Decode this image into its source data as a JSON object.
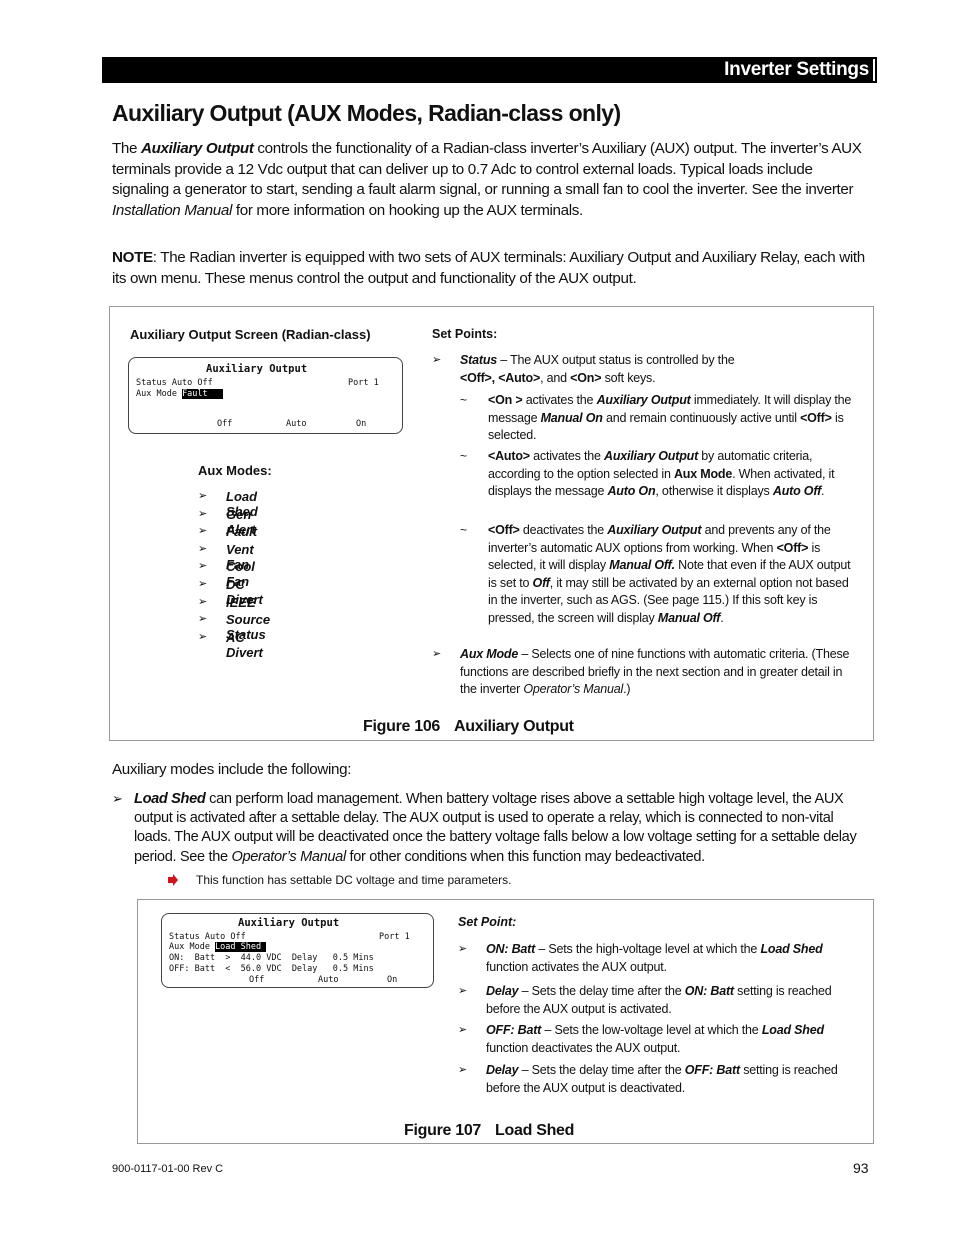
{
  "header": {
    "section_title": "Inverter Settings"
  },
  "page_title": "Auxiliary Output (AUX Modes, Radian-class only)",
  "intro": {
    "p1_a": "The ",
    "p1_em": "Auxiliary Output",
    "p1_b": " controls the functionality of a Radian-class inverter’s Auxiliary (AUX) output.  The inverter’s AUX terminals provide a 12 Vdc output that can deliver up to 0.7 Adc to control external loads.  Typical loads include signaling a generator to start, sending a fault alarm signal, or running a small fan to cool the inverter.  See the inverter ",
    "p1_i": "Installation Manual",
    "p1_c": " for more information on hooking up the AUX terminals.",
    "note_label": "NOTE",
    "note_text": ":  The Radian inverter is equipped with two sets of AUX terminals: Auxiliary Output and Auxiliary Relay, each with its own menu.  These menus control the output and functionality of the AUX output."
  },
  "figure106": {
    "screen_heading": "Auxiliary Output Screen (Radian-class)",
    "lcd": {
      "title": "Auxiliary Output",
      "status_label": "Status Auto Off",
      "port": "Port 1",
      "aux_mode_label": "Aux Mode ",
      "aux_mode_value": "Fault   ",
      "softkeys": [
        "Off",
        "Auto",
        "On"
      ]
    },
    "aux_modes_heading": "Aux Modes:",
    "aux_modes": [
      "Load Shed",
      "Gen Alert",
      "Fault",
      "Vent Fan",
      "Cool Fan",
      "DC Divert",
      "IEEE",
      "Source Status",
      "AC Divert"
    ],
    "set_points_heading": "Set Points:",
    "status_item": {
      "term": "Status",
      "text_a": " – The AUX output status is controlled by the ",
      "keys": "<Off>, <Auto>",
      "text_b": ", and ",
      "key_on": "<On>",
      "text_c": " soft keys."
    },
    "sub_items": [
      {
        "key": "<On >",
        "t1": " activates the ",
        "em1": "Auxiliary Output",
        "t2": " immediately.  It will display the message ",
        "em2": "Manual On",
        "t3": " and remain continuously active until ",
        "key2": "<Off>",
        "t4": " is selected."
      },
      {
        "key": "<Auto>",
        "t1": " activates the ",
        "em1": "Auxiliary Output",
        "t2": " by automatic criteria, according to the option selected in ",
        "b1": "Aux Mode",
        "t3": ".  When activated, it displays the message ",
        "em2": "Auto On",
        "t4": ", otherwise it displays ",
        "em3": "Auto Off",
        "t5": "."
      },
      {
        "key": "<Off>",
        "t1": " deactivates the ",
        "em1": "Auxiliary Output",
        "t2": " and prevents any of the inverter’s automatic AUX options from working.  When ",
        "key2": "<Off>",
        "t3": " is selected, it will display ",
        "em2": "Manual Off.",
        "t4": "  Note that even if the AUX output is set to ",
        "em3": "Off",
        "t5": ", it may still be activated by an external option not based in the inverter, such as AGS. (See page 115.)  If this soft key is pressed, the screen will display ",
        "em4": "Manual Off",
        "t6": "."
      }
    ],
    "aux_mode_item": {
      "term": "Aux Mode",
      "text_a": " – Selects one of nine functions with automatic criteria. (These functions are described briefly in the next section and in greater detail in the inverter ",
      "em": "Operator’s Manual",
      "text_b": ".)"
    },
    "caption_num": "Figure 106",
    "caption_title": "Auxiliary Output"
  },
  "modes_intro": "Auxiliary modes include the following:",
  "load_shed": {
    "term": "Load Shed",
    "text_a": " can perform load management.  When battery voltage rises above a settable high voltage level, the AUX output is activated after a settable delay.  The AUX output is used to operate a relay, which is connected to non-vital loads.  The AUX output will be deactivated once the battery voltage falls below a low voltage setting for a settable delay period.  See the ",
    "em": "Operator’s Manual",
    "text_b": " for other conditions when this function may bedeactivated.",
    "note": "This function has settable DC voltage and time parameters."
  },
  "figure107": {
    "lcd": {
      "title": "Auxiliary Output",
      "status_label": "Status Auto Off",
      "port": "Port 1",
      "aux_mode_label": "Aux Mode ",
      "aux_mode_value": "Load Shed ",
      "on_row": "ON:  Batt  >  44.0 VDC  Delay   0.5 Mins",
      "off_row": "OFF: Batt  <  56.0 VDC  Delay   0.5 Mins",
      "softkeys": [
        "Off",
        "Auto",
        "On"
      ]
    },
    "set_point_heading": "Set Point:",
    "items": [
      {
        "term": "ON: Batt",
        "t1": " – Sets the high-voltage level at which the ",
        "em": "Load Shed",
        "t2": " function activates the AUX output."
      },
      {
        "term": "Delay",
        "t1": " – Sets the delay time after the ",
        "em": "ON: Batt",
        "t2": " setting is reached before the AUX output is activated."
      },
      {
        "term": "OFF: Batt",
        "t1": " – Sets the low-voltage level at which the ",
        "em": "Load Shed",
        "t2": " function deactivates the AUX output."
      },
      {
        "term": "Delay",
        "t1": " – Sets the delay time after the ",
        "em": "OFF: Batt",
        "t2": " setting is reached before the AUX output is deactivated."
      }
    ],
    "caption_num": "Figure 107",
    "caption_title": "Load Shed"
  },
  "footer": {
    "doc_number": "900-0117-01-00 Rev C",
    "page_number": "93"
  },
  "icons": {
    "bullet": "arrowhead-bullet-icon",
    "tilde": "tilde-bullet-icon",
    "note_arrow": "red-arrow-icon"
  },
  "colors": {
    "note_arrow": "#d0121b",
    "header_bg": "#000000"
  }
}
